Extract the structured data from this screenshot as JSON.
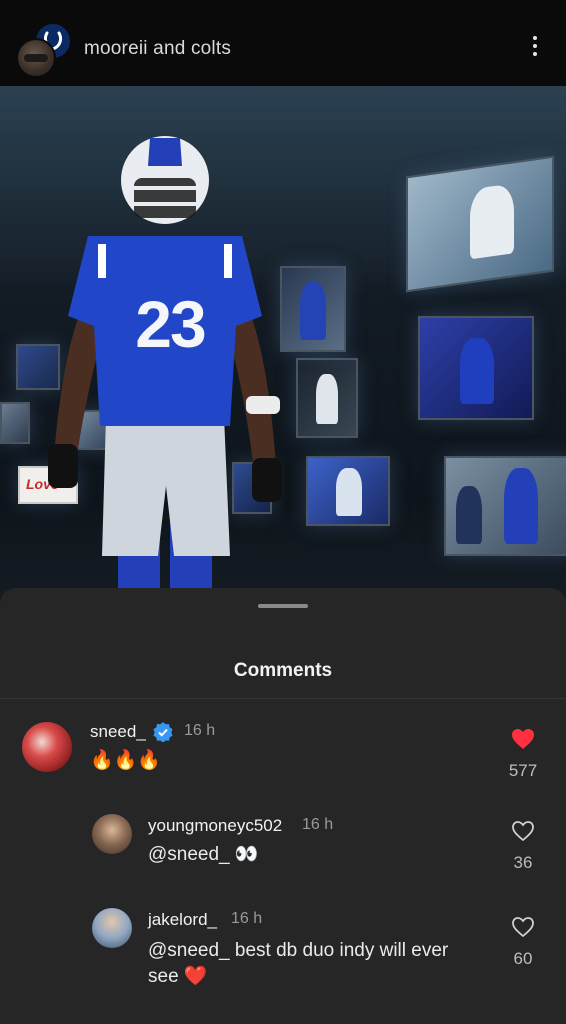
{
  "header": {
    "title": "mooreii and colts"
  },
  "hero": {
    "jersey_number": "23",
    "sign_text": "Love"
  },
  "sheet": {
    "title": "Comments"
  },
  "comments": [
    {
      "username": "sneed_",
      "verified": true,
      "time": "16 h",
      "text": "🔥🔥🔥",
      "likes": "577",
      "liked": true
    },
    {
      "username": "youngmoneyc502",
      "time": "16 h",
      "text": "@sneed_ 👀",
      "likes": "36",
      "liked": false
    },
    {
      "username": "jakelord_",
      "time": "16 h",
      "text_line1": "@sneed_ best db duo indy will ever",
      "text_line2": "see ❤️",
      "likes": "60",
      "liked": false
    }
  ],
  "colors": {
    "accent_like": "#ff3040",
    "verified_blue": "#3897f0",
    "colts_blue": "#1f3fbf"
  }
}
